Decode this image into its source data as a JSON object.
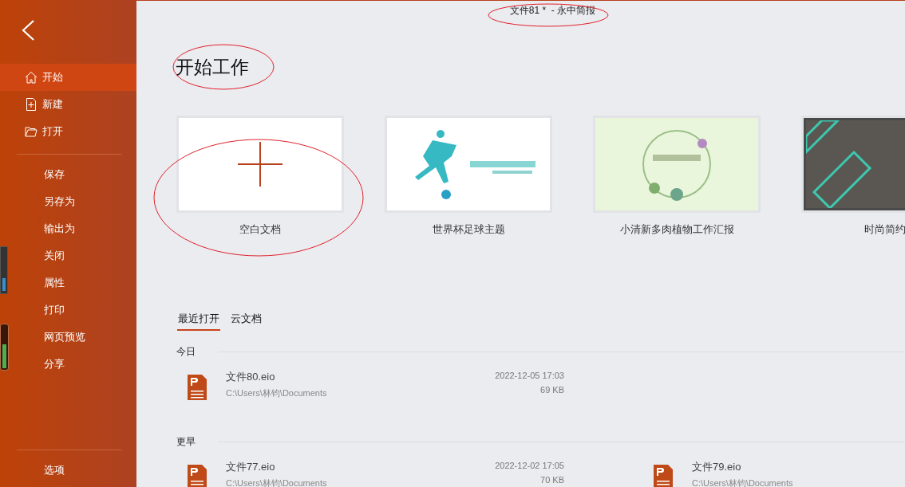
{
  "window": {
    "title": "文件81 *  - 永中简报"
  },
  "sidebar": {
    "top_items": [
      {
        "label": "开始",
        "selected": true
      },
      {
        "label": "新建",
        "selected": false
      },
      {
        "label": "打开",
        "selected": false
      }
    ],
    "items": [
      {
        "label": "保存",
        "selected": false
      },
      {
        "label": "另存为",
        "selected": false
      },
      {
        "label": "输出为",
        "selected": false
      },
      {
        "label": "关闭",
        "selected": false
      },
      {
        "label": "属性",
        "selected": false
      },
      {
        "label": "打印",
        "selected": false
      },
      {
        "label": "网页预览",
        "selected": false
      },
      {
        "label": "分享",
        "selected": false
      }
    ],
    "bottom_items": [
      {
        "label": "选项",
        "selected": false
      }
    ]
  },
  "heading": "开始工作",
  "templates": [
    {
      "label": "空白文档",
      "kind": "blank"
    },
    {
      "label": "世界杯足球主题",
      "kind": "white"
    },
    {
      "label": "小清新多肉植物工作汇报",
      "kind": "green"
    },
    {
      "label": "时尚简约",
      "kind": "dark"
    }
  ],
  "recent_tabs": [
    {
      "label": "最近打开",
      "selected": true
    },
    {
      "label": "云文档",
      "selected": false
    }
  ],
  "groups": [
    {
      "label": "今日",
      "files": [
        {
          "name": "文件80.eio",
          "path": "C:\\Users\\林钧\\Documents",
          "date": "2022-12-05 17:03",
          "size": "69 KB"
        }
      ]
    },
    {
      "label": "更早",
      "files": [
        {
          "name": "文件77.eio",
          "path": "C:\\Users\\林钧\\Documents",
          "date": "2022-12-02 17:05",
          "size": "70 KB"
        },
        {
          "name": "文件79.eio",
          "path": "C:\\Users\\林钧\\Documents"
        }
      ]
    }
  ]
}
